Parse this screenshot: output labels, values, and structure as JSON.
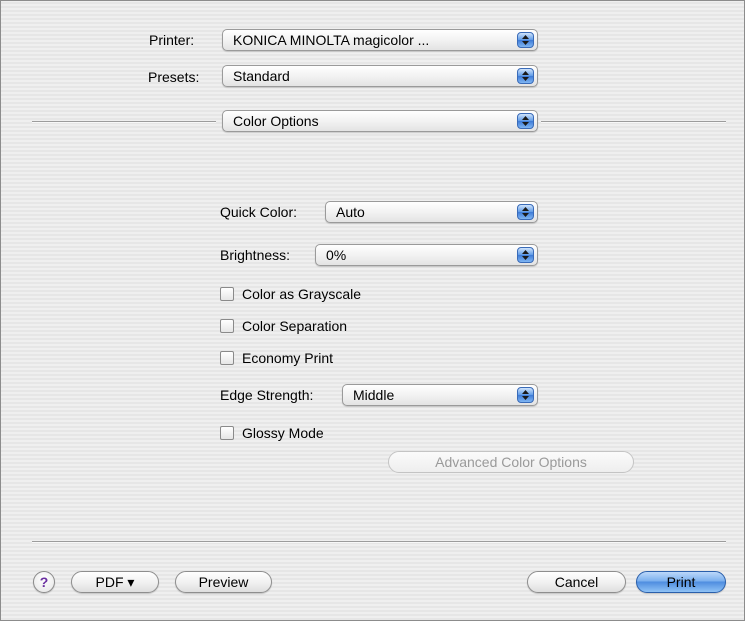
{
  "dialog": {
    "printer": {
      "label": "Printer:",
      "value": "KONICA MINOLTA magicolor ..."
    },
    "presets": {
      "label": "Presets:",
      "value": "Standard"
    },
    "pane": {
      "value": "Color Options"
    }
  },
  "options": {
    "quick_color": {
      "label": "Quick Color:",
      "value": "Auto"
    },
    "brightness": {
      "label": "Brightness:",
      "value": "0%"
    },
    "color_as_grayscale": {
      "label": "Color as Grayscale",
      "checked": false
    },
    "color_separation": {
      "label": "Color Separation",
      "checked": false
    },
    "economy_print": {
      "label": "Economy Print",
      "checked": false
    },
    "edge_strength": {
      "label": "Edge Strength:",
      "value": "Middle"
    },
    "glossy_mode": {
      "label": "Glossy Mode",
      "checked": false
    },
    "advanced_button": "Advanced Color Options"
  },
  "footer": {
    "help": "?",
    "pdf": "PDF ▾",
    "preview": "Preview",
    "cancel": "Cancel",
    "print": "Print"
  },
  "colors": {
    "accent": "#5e9ae6",
    "help_glyph": "#6a2fa0"
  }
}
